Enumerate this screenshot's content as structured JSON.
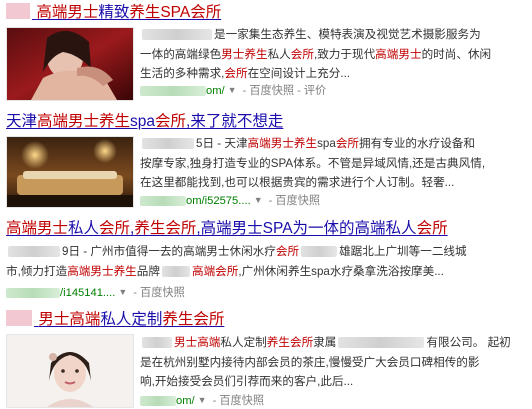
{
  "results": [
    {
      "title": [
        {
          "t": "高端男士",
          "h": true
        },
        {
          "t": "精致",
          "h": false
        },
        {
          "t": "养生SPA会所",
          "h": true
        }
      ],
      "snippet_lines": [
        [
          {
            "blur": 70
          },
          {
            "t": "是一家集生态养生、模特表演及视觉艺术摄影服务为"
          }
        ],
        [
          {
            "t": "一体的高端绿色"
          },
          {
            "t": "男士养生",
            "h": true
          },
          {
            "t": "私人"
          },
          {
            "t": "会所",
            "h": true
          },
          {
            "t": ",致力于现代"
          },
          {
            "t": "高端男士",
            "h": true
          },
          {
            "t": "的时尚、休闲"
          }
        ],
        [
          {
            "t": "生活的多种需求,"
          },
          {
            "t": "会所",
            "h": true
          },
          {
            "t": "在空间设计上充分..."
          }
        ]
      ],
      "url": "om/",
      "cache": "百度快照",
      "review": "评价"
    },
    {
      "title": [
        {
          "t": "天津",
          "h": false
        },
        {
          "t": "高端男士养生",
          "h": true
        },
        {
          "t": "spa",
          "h": false
        },
        {
          "t": "会所",
          "h": true
        },
        {
          "t": ",来了就不想走",
          "h": false
        }
      ],
      "snippet_lines": [
        [
          {
            "blur": 52
          },
          {
            "t": "5日 - 天津"
          },
          {
            "t": "高端男士养生",
            "h": true
          },
          {
            "t": "spa"
          },
          {
            "t": "会所",
            "h": true
          },
          {
            "t": "拥有专业的水疗设备和"
          }
        ],
        [
          {
            "t": "按摩专家,独身打造专业的SPA体系。不管是异域风情,还是古典风情,"
          }
        ],
        [
          {
            "t": "在这里都能找到,也可以根据贵宾的需求进行个人订制。轻奢..."
          }
        ]
      ],
      "url": "om/i52575....",
      "cache": "百度快照"
    },
    {
      "title": [
        {
          "t": "高端男士",
          "h": true
        },
        {
          "t": "私人",
          "h": false
        },
        {
          "t": "会所",
          "h": true
        },
        {
          "t": ",",
          "h": false
        },
        {
          "t": "养生会所",
          "h": true
        },
        {
          "t": ",高端男士SPA为一体的高端私人",
          "h": false
        },
        {
          "t": "会所",
          "h": true
        }
      ],
      "snippet_lines": [
        [
          {
            "blur": 52
          },
          {
            "t": "9日 - 广州市值得一去的高端男士休闲水疗"
          },
          {
            "t": "会所",
            "h": true
          },
          {
            "blur": 36
          },
          {
            "t": "雄踞北上广圳等一二线城"
          }
        ],
        [
          {
            "t": "市,倾力打造"
          },
          {
            "t": "高端男士养生",
            "h": true
          },
          {
            "t": "品牌"
          },
          {
            "blur": 28
          },
          {
            "t": "高端会所",
            "h": true
          },
          {
            "t": ",广州休闲养生spa水疗桑拿洗浴按摩美..."
          }
        ]
      ],
      "url": "/i145141....",
      "cache": "百度快照"
    },
    {
      "title": [
        {
          "t": "男士高端",
          "h": true
        },
        {
          "t": "私人定制",
          "h": false
        },
        {
          "t": "养生会所",
          "h": true
        }
      ],
      "snippet_lines": [
        [
          {
            "blur": 30
          },
          {
            "t": "男士高端",
            "h": true
          },
          {
            "t": "私人定制"
          },
          {
            "t": "养生会所",
            "h": true
          },
          {
            "t": "隶属"
          },
          {
            "blur": 86
          },
          {
            "t": "有限公司。 起初"
          }
        ],
        [
          {
            "t": "是在杭州别墅内接待内部会员的茶庄,慢慢受广大会员口碑相传的影"
          }
        ],
        [
          {
            "t": "响,开始接受会员们引荐而来的客户,此后..."
          }
        ]
      ],
      "url": "om/",
      "cache": "百度快照"
    }
  ],
  "colors": {
    "title": "#1a0dab",
    "highlight": "#c00000",
    "url": "#008000",
    "meta": "#808080"
  },
  "icons": [
    "caret-down-icon"
  ]
}
